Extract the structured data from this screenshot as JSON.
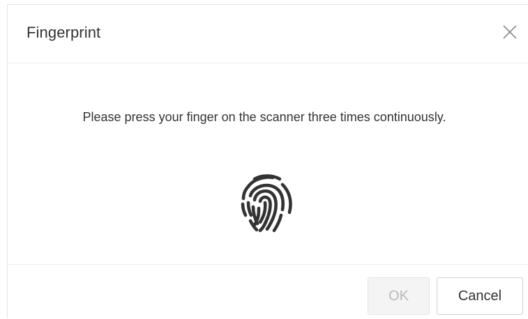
{
  "dialog": {
    "title": "Fingerprint",
    "close_icon": "close-icon",
    "instruction": "Please press your finger on the scanner three times continuously.",
    "fingerprint_icon": "fingerprint-icon",
    "buttons": {
      "ok_label": "OK",
      "ok_disabled": true,
      "cancel_label": "Cancel"
    }
  },
  "colors": {
    "text": "#333333",
    "disabled_text": "#b9b9b9",
    "icon": "#333333"
  }
}
